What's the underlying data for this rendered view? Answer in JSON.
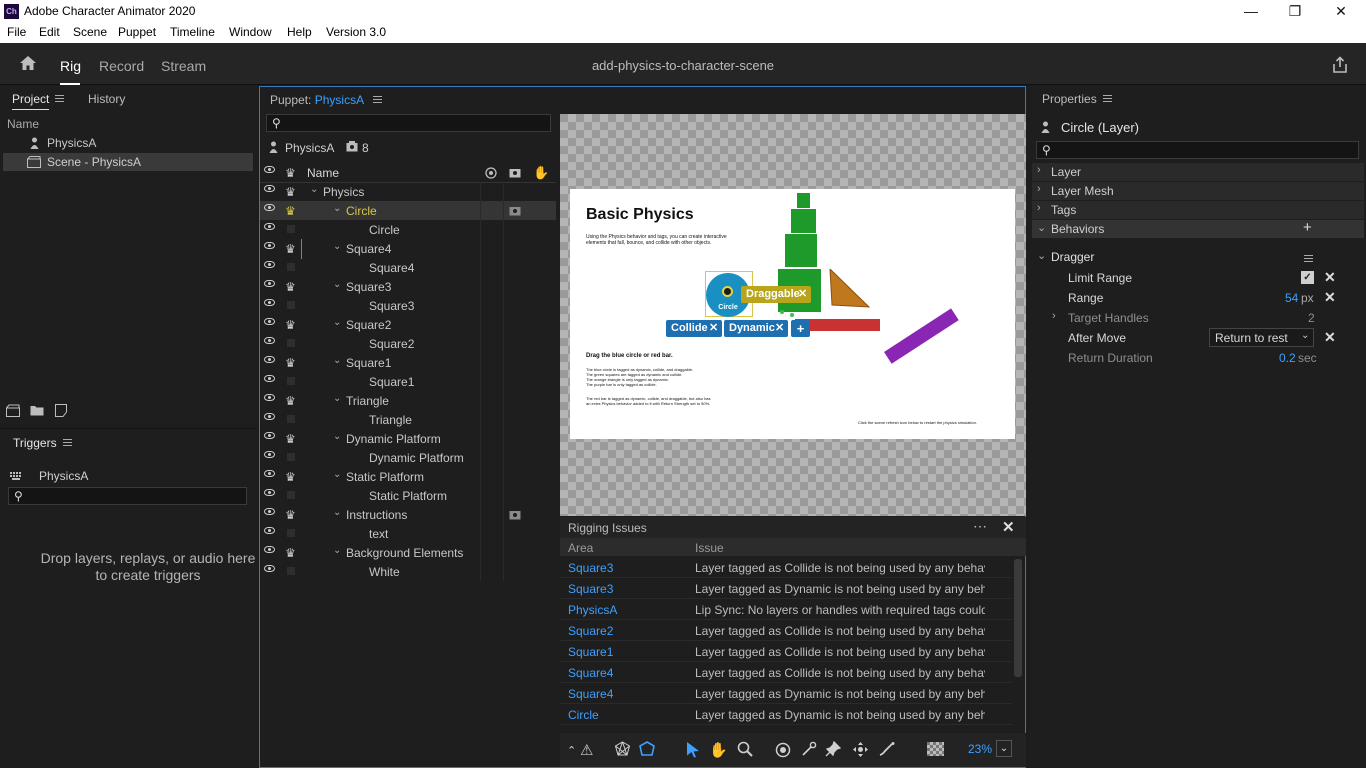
{
  "window": {
    "title": "Adobe Character Animator 2020",
    "icon_text": "Ch",
    "minimize": "—",
    "maximize": "❐",
    "close": "✕"
  },
  "menu": [
    "File",
    "Edit",
    "Scene",
    "Puppet",
    "Timeline",
    "Window",
    "Help",
    "Version 3.0"
  ],
  "modes": {
    "home_icon": "home-icon",
    "rig": "Rig",
    "record": "Record",
    "stream": "Stream",
    "active": "Rig"
  },
  "document_title": "add-physics-to-character-scene",
  "project": {
    "tab_project": "Project",
    "tab_history": "History",
    "col_name": "Name",
    "items": [
      {
        "name": "PhysicsA",
        "icon": "puppet-icon"
      },
      {
        "name": "Scene - PhysicsA",
        "icon": "scene-icon",
        "selected": true
      }
    ]
  },
  "triggers": {
    "title": "Triggers",
    "puppet": "PhysicsA",
    "empty_text": "Drop layers, replays, or audio here to create triggers"
  },
  "puppet_panel": {
    "label": "Puppet:",
    "puppet_name": "PhysicsA",
    "root_name": "PhysicsA",
    "layer_count": "8",
    "col_name": "Name",
    "rows": [
      {
        "name": "Physics",
        "indent": 0,
        "group": true
      },
      {
        "name": "Circle",
        "indent": 1,
        "group": true,
        "selected": true
      },
      {
        "name": "Circle",
        "indent": 2,
        "group": false
      },
      {
        "name": "Square4",
        "indent": 1,
        "group": true
      },
      {
        "name": "Square4",
        "indent": 2,
        "group": false
      },
      {
        "name": "Square3",
        "indent": 1,
        "group": true
      },
      {
        "name": "Square3",
        "indent": 2,
        "group": false
      },
      {
        "name": "Square2",
        "indent": 1,
        "group": true
      },
      {
        "name": "Square2",
        "indent": 2,
        "group": false
      },
      {
        "name": "Square1",
        "indent": 1,
        "group": true
      },
      {
        "name": "Square1",
        "indent": 2,
        "group": false
      },
      {
        "name": "Triangle",
        "indent": 1,
        "group": true
      },
      {
        "name": "Triangle",
        "indent": 2,
        "group": false
      },
      {
        "name": "Dynamic Platform",
        "indent": 1,
        "group": true
      },
      {
        "name": "Dynamic Platform",
        "indent": 2,
        "group": false
      },
      {
        "name": "Static Platform",
        "indent": 1,
        "group": true
      },
      {
        "name": "Static Platform",
        "indent": 2,
        "group": false
      },
      {
        "name": "Instructions",
        "indent": 1,
        "group": true
      },
      {
        "name": "text",
        "indent": 2,
        "group": false
      },
      {
        "name": "Background Elements",
        "indent": 1,
        "group": true
      },
      {
        "name": "White",
        "indent": 2,
        "group": false
      }
    ]
  },
  "canvas": {
    "heading": "Basic Physics",
    "intro": "Using the Physics behavior and tags, you can create interactive elements that fall, bounce, and collide with other objects.",
    "drag_title": "Drag the blue circle or red bar.",
    "notes": [
      "The blue circle is tagged as dynamic, collide, and draggable.",
      "The green squares are tagged as dynamic and collide.",
      "The orange triangle is only tagged as dynamic.",
      "The purple bar is only tagged as collide."
    ],
    "red_bar_note": "The red bar is tagged as dynamic, collide, and draggable, but also has an extra Physics behavior added to it with Return Strength set to 50%.",
    "footer": "Click the scene refresh icon below to restart the physics simulation.",
    "circle_label": "Circle",
    "tags": {
      "draggable": "Draggable",
      "collide": "Collide",
      "dynamic": "Dynamic",
      "add": "+"
    },
    "colors": {
      "blue": "#1a8fc2",
      "green": "#1e9a2a",
      "orange": "#c0781f",
      "red": "#c93232",
      "purple": "#8a26b4",
      "tag": "#1e6fb0",
      "draggable_tag": "#b8a51c"
    }
  },
  "rigging": {
    "title": "Rigging Issues",
    "col_area": "Area",
    "col_issue": "Issue",
    "rows": [
      {
        "area": "Square3",
        "issue": "Layer tagged as Collide is not being used by any behavio..."
      },
      {
        "area": "Square3",
        "issue": "Layer tagged as Dynamic is not being used by any behav..."
      },
      {
        "area": "PhysicsA",
        "issue": "Lip Sync: No layers or handles with required tags could l..."
      },
      {
        "area": "Square2",
        "issue": "Layer tagged as Collide is not being used by any behavio..."
      },
      {
        "area": "Square1",
        "issue": "Layer tagged as Collide is not being used by any behavio..."
      },
      {
        "area": "Square4",
        "issue": "Layer tagged as Collide is not being used by any behavio..."
      },
      {
        "area": "Square4",
        "issue": "Layer tagged as Dynamic is not being used by any behav..."
      },
      {
        "area": "Circle",
        "issue": "Layer tagged as Dynamic is not being used by any behavio..."
      }
    ]
  },
  "toolbar": {
    "zoom": "23%"
  },
  "properties": {
    "title": "Properties",
    "selection": "Circle (Layer)",
    "sections": [
      "Layer",
      "Layer Mesh",
      "Tags",
      "Behaviors"
    ],
    "behavior": "Dragger",
    "params": {
      "limit_range": "Limit Range",
      "range": "Range",
      "range_value": "54",
      "range_unit": "px",
      "target_handles": "Target Handles",
      "target_handles_value": "2",
      "after_move": "After Move",
      "after_move_value": "Return to rest",
      "return_duration": "Return Duration",
      "return_duration_value": "0.2",
      "return_duration_unit": "sec"
    }
  }
}
